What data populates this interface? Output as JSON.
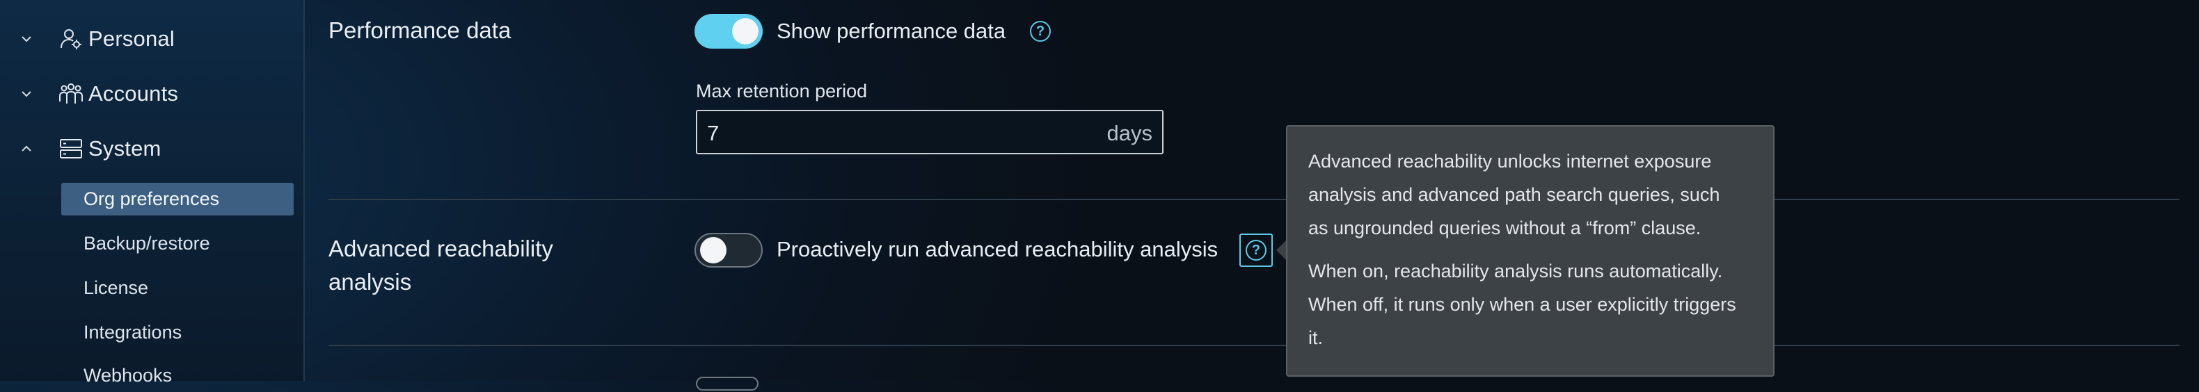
{
  "sidebar": {
    "groups": [
      {
        "label": "Personal",
        "chevron": "chevron-down",
        "icon": "user-gear-icon"
      },
      {
        "label": "Accounts",
        "chevron": "chevron-down",
        "icon": "users-icon"
      },
      {
        "label": "System",
        "chevron": "chevron-up",
        "icon": "server-icon"
      }
    ],
    "system_items": [
      {
        "label": "Org preferences",
        "active": true
      },
      {
        "label": "Backup/restore"
      },
      {
        "label": "License"
      },
      {
        "label": "Integrations"
      },
      {
        "label": "Webhooks"
      }
    ]
  },
  "performance": {
    "title": "Performance data",
    "toggle_label": "Show performance data",
    "toggle_on": true,
    "retention_label": "Max retention period",
    "retention_value": "7",
    "retention_unit": "days"
  },
  "reachability": {
    "title_line1": "Advanced reachability",
    "title_line2": "analysis",
    "toggle_label": "Proactively run advanced reachability analysis",
    "toggle_on": false
  },
  "tooltip": {
    "line1": "Advanced reachability unlocks internet exposure",
    "line2": "analysis and advanced path search queries, such",
    "line3": "as ungrounded queries without a “from” clause.",
    "line4": "When on, reachability analysis runs automatically.",
    "line5": "When off, it runs only when a user explicitly triggers",
    "line6": "it."
  },
  "help_glyph": "?",
  "colors": {
    "accent": "#5cc8e6",
    "toggle_on": "#5fd0ef",
    "active_nav": "#3c5f82",
    "tooltip_bg": "#3d4246"
  }
}
